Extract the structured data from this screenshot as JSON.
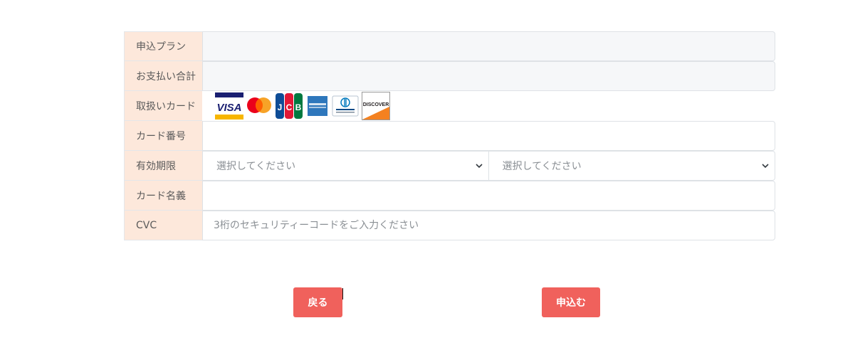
{
  "form": {
    "plan": {
      "label": "申込プラン",
      "value": ""
    },
    "total": {
      "label": "お支払い合計",
      "value": ""
    },
    "cards": {
      "label": "取扱いカード",
      "brands": [
        "VISA",
        "mastercard",
        "JCB",
        "AMERICAN EXPRESS",
        "Diners Club INTERNATIONAL",
        "DISCOVER"
      ]
    },
    "card_number": {
      "label": "カード番号",
      "value": ""
    },
    "expiry": {
      "label": "有効期限",
      "month_selected": "選択してください",
      "year_selected": "選択してください"
    },
    "card_name": {
      "label": "カード名義",
      "value": ""
    },
    "cvc": {
      "label": "CVC",
      "placeholder": "3桁のセキュリティーコードをご入力ください"
    }
  },
  "buttons": {
    "back_label": "戻る",
    "submit_label": "申込む"
  },
  "colors": {
    "label_bg": "#fde8db",
    "readonly_bg": "#f6f7f9",
    "button_bg": "#f0615c"
  }
}
